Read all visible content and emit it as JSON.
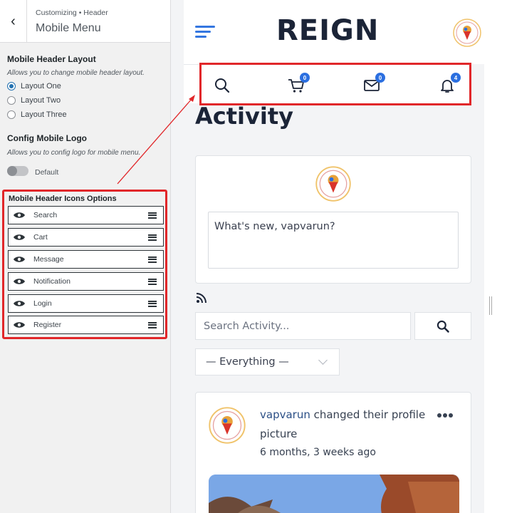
{
  "customizer": {
    "breadcrumb": "Customizing • Header",
    "section_title": "Mobile Menu",
    "layout": {
      "title": "Mobile Header Layout",
      "description": "Allows you to change mobile header layout.",
      "options": [
        "Layout One",
        "Layout Two",
        "Layout Three"
      ],
      "selected": "Layout One"
    },
    "logo": {
      "title": "Config Mobile Logo",
      "description": "Allows you to config logo for mobile menu.",
      "toggle_label": "Default"
    },
    "icons": {
      "title": "Mobile Header Icons Options",
      "items": [
        "Search",
        "Cart",
        "Message",
        "Notification",
        "Login",
        "Register"
      ]
    }
  },
  "preview": {
    "logo": "REIGN",
    "badges": {
      "cart": "0",
      "message": "0",
      "notification": "4"
    },
    "page_title": "Activity",
    "post_placeholder": "What's new, vapvarun?",
    "search_placeholder": "Search Activity...",
    "filter_value": "— Everything —",
    "card": {
      "user": "vapvarun",
      "action": " changed their profile picture",
      "time": "6 months, 3 weeks ago"
    }
  },
  "colors": {
    "accent": "#2b6fe0",
    "highlight": "#e1272a",
    "logo": "#1b2437"
  }
}
